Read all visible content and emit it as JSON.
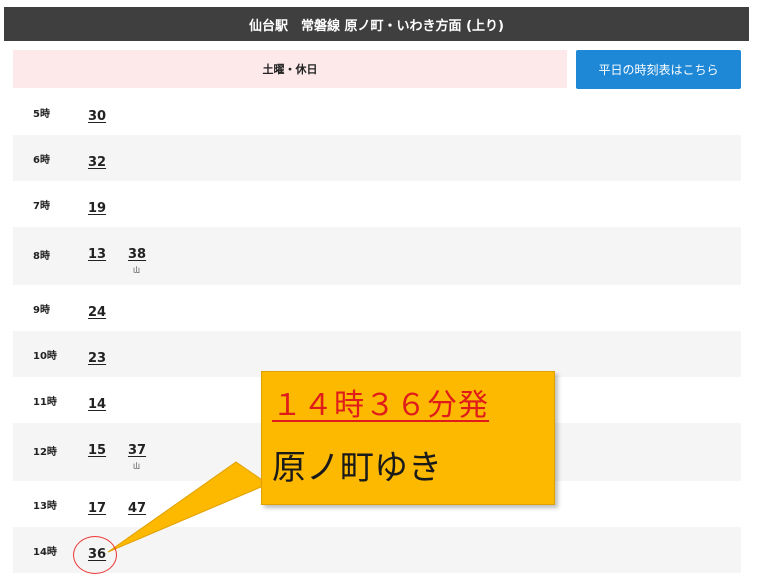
{
  "header": {
    "title": "仙台駅　常磐線 原ノ町・いわき方面 (上り)"
  },
  "day_type": {
    "label": "土曜・休日"
  },
  "weekday_link": {
    "label": "平日の時刻表はこちら"
  },
  "timetable": [
    {
      "hour": "5時",
      "departures": [
        {
          "minute": "30",
          "note": ""
        }
      ]
    },
    {
      "hour": "6時",
      "departures": [
        {
          "minute": "32",
          "note": ""
        }
      ]
    },
    {
      "hour": "7時",
      "departures": [
        {
          "minute": "19",
          "note": ""
        }
      ]
    },
    {
      "hour": "8時",
      "departures": [
        {
          "minute": "13",
          "note": ""
        },
        {
          "minute": "38",
          "note": "山"
        }
      ]
    },
    {
      "hour": "9時",
      "departures": [
        {
          "minute": "24",
          "note": ""
        }
      ]
    },
    {
      "hour": "10時",
      "departures": [
        {
          "minute": "23",
          "note": ""
        }
      ]
    },
    {
      "hour": "11時",
      "departures": [
        {
          "minute": "14",
          "note": ""
        }
      ]
    },
    {
      "hour": "12時",
      "departures": [
        {
          "minute": "15",
          "note": ""
        },
        {
          "minute": "37",
          "note": "山"
        }
      ]
    },
    {
      "hour": "13時",
      "departures": [
        {
          "minute": "17",
          "note": ""
        },
        {
          "minute": "47",
          "note": ""
        }
      ]
    },
    {
      "hour": "14時",
      "departures": [
        {
          "minute": "36",
          "note": ""
        }
      ]
    }
  ],
  "callout": {
    "line1": "１４時３６分発",
    "line2": "原ノ町ゆき"
  },
  "colors": {
    "header_bg": "#3f3f3f",
    "day_label_bg": "#fde8ea",
    "button_bg": "#1e88d6",
    "callout_bg": "#fcb900",
    "callout_accent": "#e01b1b"
  }
}
